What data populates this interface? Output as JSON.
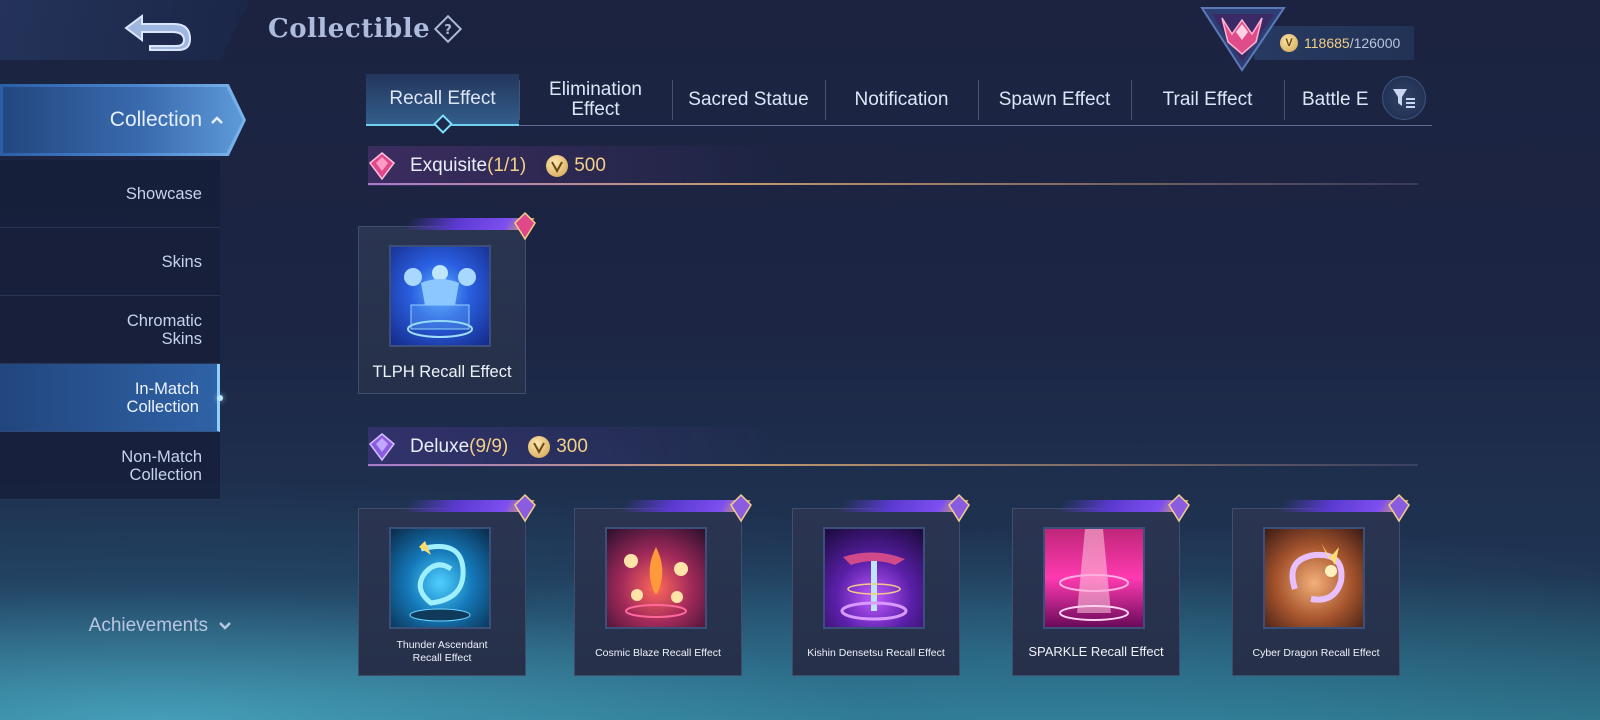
{
  "header": {
    "title": "Collectible",
    "points_current": "118685",
    "points_separator": "/",
    "points_max": "126000"
  },
  "sidebar": {
    "collection_label": "Collection",
    "items": [
      {
        "label": "Showcase",
        "active": false
      },
      {
        "label": "Skins",
        "active": false
      },
      {
        "label": "Chromatic Skins",
        "active": false
      },
      {
        "label": "In-Match Collection",
        "active": true
      },
      {
        "label": "Non-Match Collection",
        "active": false
      }
    ],
    "achievements_label": "Achievements"
  },
  "tabs": [
    {
      "label": "Recall Effect",
      "active": true
    },
    {
      "label": "Elimination Effect",
      "active": false
    },
    {
      "label": "Sacred Statue",
      "active": false
    },
    {
      "label": "Notification",
      "active": false
    },
    {
      "label": "Spawn Effect",
      "active": false
    },
    {
      "label": "Trail Effect",
      "active": false
    },
    {
      "label": "Battle E",
      "active": false
    }
  ],
  "sections": {
    "exquisite": {
      "name": "Exquisite",
      "count": "(1/1)",
      "price": "500",
      "items": [
        {
          "label": "TLPH Recall Effect",
          "icon": "titan-hologram-icon"
        }
      ]
    },
    "deluxe": {
      "name": "Deluxe",
      "count": "(9/9)",
      "price": "300",
      "items": [
        {
          "label": "Thunder Ascendant Recall Effect",
          "icon": "thunder-dragon-icon"
        },
        {
          "label": "Cosmic Blaze Recall Effect",
          "icon": "cosmic-blaze-icon"
        },
        {
          "label": "Kishin Densetsu Recall Effect",
          "icon": "kishin-icon"
        },
        {
          "label": "SPARKLE Recall Effect",
          "icon": "sparkle-icon"
        },
        {
          "label": "Cyber Dragon Recall Effect",
          "icon": "cyber-dragon-icon"
        }
      ]
    }
  },
  "colors": {
    "accent": "#6fd0f0",
    "gold": "#f2d089",
    "exquisite_gem": "#e0488a",
    "deluxe_gem": "#8a5de0"
  }
}
